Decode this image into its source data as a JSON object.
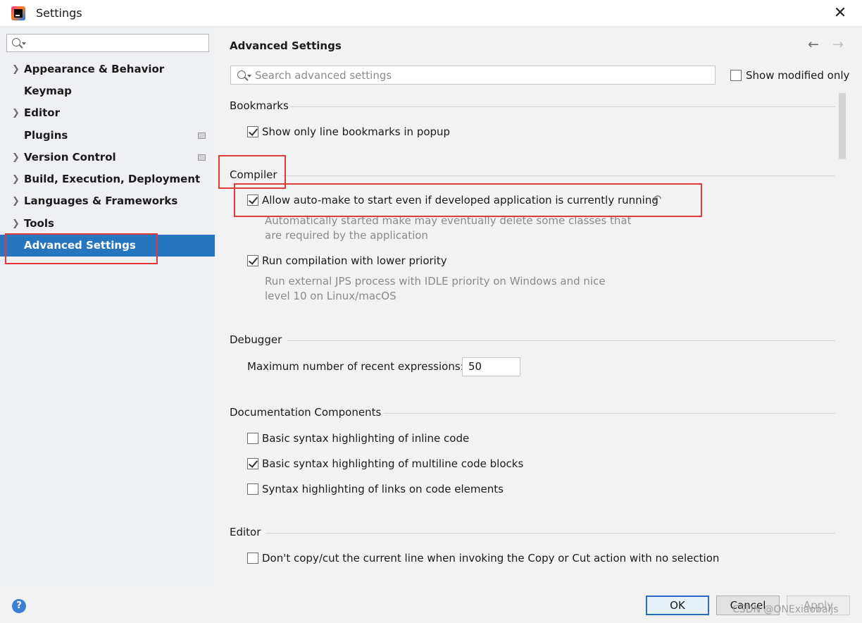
{
  "window": {
    "title": "Settings",
    "close_symbol": "✕"
  },
  "sidebar": {
    "search_placeholder": "",
    "items": [
      {
        "label": "Appearance & Behavior",
        "expandable": true,
        "has_doc_icon": false,
        "selected": false
      },
      {
        "label": "Keymap",
        "expandable": false,
        "has_doc_icon": false,
        "selected": false
      },
      {
        "label": "Editor",
        "expandable": true,
        "has_doc_icon": false,
        "selected": false
      },
      {
        "label": "Plugins",
        "expandable": false,
        "has_doc_icon": true,
        "selected": false
      },
      {
        "label": "Version Control",
        "expandable": true,
        "has_doc_icon": true,
        "selected": false
      },
      {
        "label": "Build, Execution, Deployment",
        "expandable": true,
        "has_doc_icon": false,
        "selected": false
      },
      {
        "label": "Languages & Frameworks",
        "expandable": true,
        "has_doc_icon": false,
        "selected": false
      },
      {
        "label": "Tools",
        "expandable": true,
        "has_doc_icon": false,
        "selected": false
      },
      {
        "label": "Advanced Settings",
        "expandable": false,
        "has_doc_icon": false,
        "selected": true
      }
    ],
    "chevron": "❯"
  },
  "main": {
    "title": "Advanced Settings",
    "back_arrow": "←",
    "forward_arrow": "→",
    "search_placeholder": "Search advanced settings",
    "show_modified_label": "Show modified only",
    "show_modified_checked": false,
    "sections": {
      "bookmarks": {
        "title": "Bookmarks",
        "option_label": "Show only line bookmarks in popup",
        "option_checked": true
      },
      "compiler": {
        "title": "Compiler",
        "auto_make_label": "Allow auto-make to start even if developed application is currently running",
        "auto_make_checked": true,
        "auto_make_revert_icon": "↶",
        "auto_make_hint_1": "Automatically started make may eventually delete some classes that",
        "auto_make_hint_2": "are required by the application",
        "low_priority_label": "Run compilation with lower priority",
        "low_priority_checked": true,
        "low_priority_hint_1": "Run external JPS process with IDLE priority on Windows and nice",
        "low_priority_hint_2": "level 10 on Linux/macOS"
      },
      "debugger": {
        "title": "Debugger",
        "max_expr_label": "Maximum number of recent expressions:",
        "max_expr_value": "50"
      },
      "documentation": {
        "title": "Documentation Components",
        "inline_label": "Basic syntax highlighting of inline code",
        "inline_checked": false,
        "multiline_label": "Basic syntax highlighting of multiline code blocks",
        "multiline_checked": true,
        "links_label": "Syntax highlighting of links on code elements",
        "links_checked": false
      },
      "editor": {
        "title": "Editor",
        "copy_cut_label": "Don't copy/cut the current line when invoking the Copy or Cut action with no selection",
        "copy_cut_checked": false
      }
    }
  },
  "footer": {
    "help_symbol": "?",
    "ok_label": "OK",
    "cancel_label": "Cancel",
    "apply_label": "Apply",
    "watermark": "CSDN @ONExiaobaijs"
  },
  "colors": {
    "selection": "#2675bf",
    "highlight_box": "#e03a3a",
    "sidebar_bg": "#eef0f3",
    "content_bg": "#f2f2f2"
  }
}
